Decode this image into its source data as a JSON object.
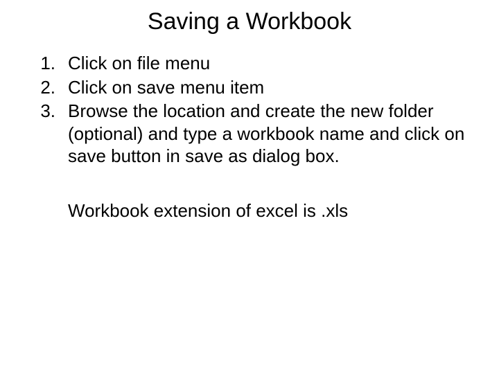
{
  "title": "Saving a Workbook",
  "steps": [
    {
      "num": "1.",
      "text": "Click on file menu"
    },
    {
      "num": "2.",
      "text": "Click on save menu item"
    },
    {
      "num": "3.",
      "text": "Browse the location and create the new folder (optional) and type a workbook name and click on save button in save as dialog box."
    }
  ],
  "footnote": "Workbook extension of excel is .xls"
}
